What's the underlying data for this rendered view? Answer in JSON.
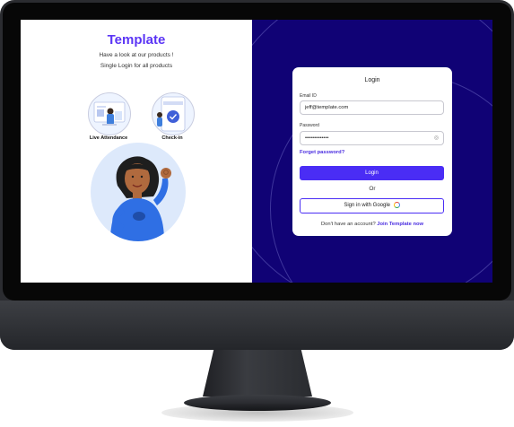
{
  "brand": {
    "title": "Template",
    "tagline1": "Have a look at our products !",
    "tagline2": "Single Login for all products"
  },
  "products": [
    {
      "label": "Live Attendance",
      "icon": "attendance-illustration-icon"
    },
    {
      "label": "Check-in",
      "icon": "checkin-illustration-icon"
    }
  ],
  "hero": {
    "icon": "woman-ok-gesture-illustration"
  },
  "login": {
    "title": "Login",
    "email_label": "Email ID",
    "email_value": "jeff@template.com",
    "password_label": "Password",
    "password_value": "•••••••••••••",
    "forgot": "Forget password?",
    "login_button": "Login",
    "or": "Or",
    "google_button": "Sign in with Google",
    "signup_text": "Don't have an account?",
    "signup_link": "Join Template now"
  },
  "colors": {
    "accent": "#4a2df5",
    "brand": "#5b35f5",
    "right_panel": "#100275"
  }
}
